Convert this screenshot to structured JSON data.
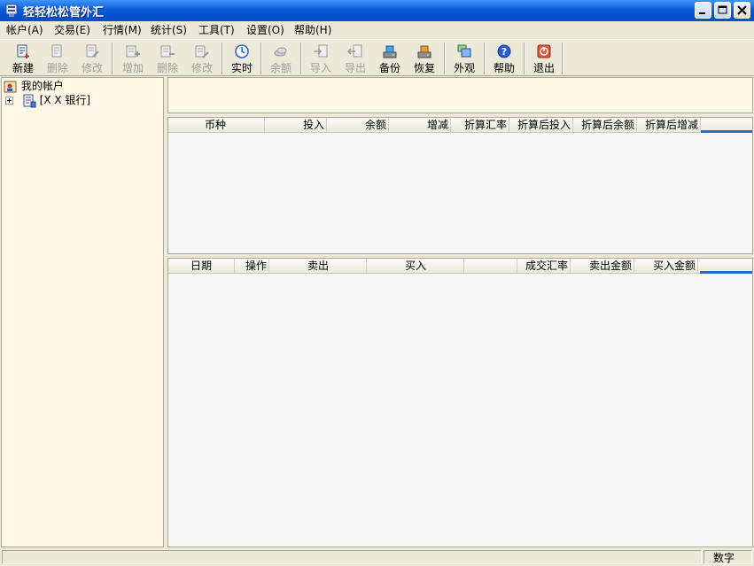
{
  "window": {
    "title": "轻轻松松管外汇"
  },
  "menu": [
    "帐户(A)",
    "交易(E)",
    "行情(M)",
    "统计(S)",
    "工具(T)",
    "设置(O)",
    "帮助(H)"
  ],
  "toolbar": [
    {
      "label": "新建",
      "icon": "new-account-icon",
      "enabled": true
    },
    {
      "label": "删除",
      "icon": "delete-account-icon",
      "enabled": false
    },
    {
      "label": "修改",
      "icon": "edit-account-icon",
      "enabled": false
    },
    {
      "label": "增加",
      "icon": "add-trade-icon",
      "enabled": false
    },
    {
      "label": "删除",
      "icon": "delete-trade-icon",
      "enabled": false
    },
    {
      "label": "修改",
      "icon": "edit-trade-icon",
      "enabled": false
    },
    {
      "label": "实时",
      "icon": "clock-icon",
      "enabled": true
    },
    {
      "label": "余额",
      "icon": "balance-icon",
      "enabled": false
    },
    {
      "label": "导入",
      "icon": "import-icon",
      "enabled": false
    },
    {
      "label": "导出",
      "icon": "export-icon",
      "enabled": false
    },
    {
      "label": "备份",
      "icon": "backup-icon",
      "enabled": true
    },
    {
      "label": "恢复",
      "icon": "restore-icon",
      "enabled": true
    },
    {
      "label": "外观",
      "icon": "appearance-icon",
      "enabled": true
    },
    {
      "label": "帮助",
      "icon": "help-icon",
      "enabled": true
    },
    {
      "label": "退出",
      "icon": "exit-icon",
      "enabled": true
    }
  ],
  "tree": {
    "root": "我的帐户",
    "child": "[X X 银行]"
  },
  "summary_table": {
    "columns": [
      "币种",
      "投入",
      "余额",
      "增减",
      "折算汇率",
      "折算后投入",
      "折算后余额",
      "折算后增减"
    ],
    "rows": []
  },
  "trade_table": {
    "columns": [
      "日期",
      "操作",
      "卖出",
      "",
      "买入",
      "",
      "成交汇率",
      "卖出金额",
      "买入金额"
    ],
    "rows": []
  },
  "status": {
    "mode": "数字"
  },
  "colors": {
    "panel_bg": "#fff8e7",
    "title_bar": "#0a5fd9",
    "selection_accent": "#316ac5"
  }
}
